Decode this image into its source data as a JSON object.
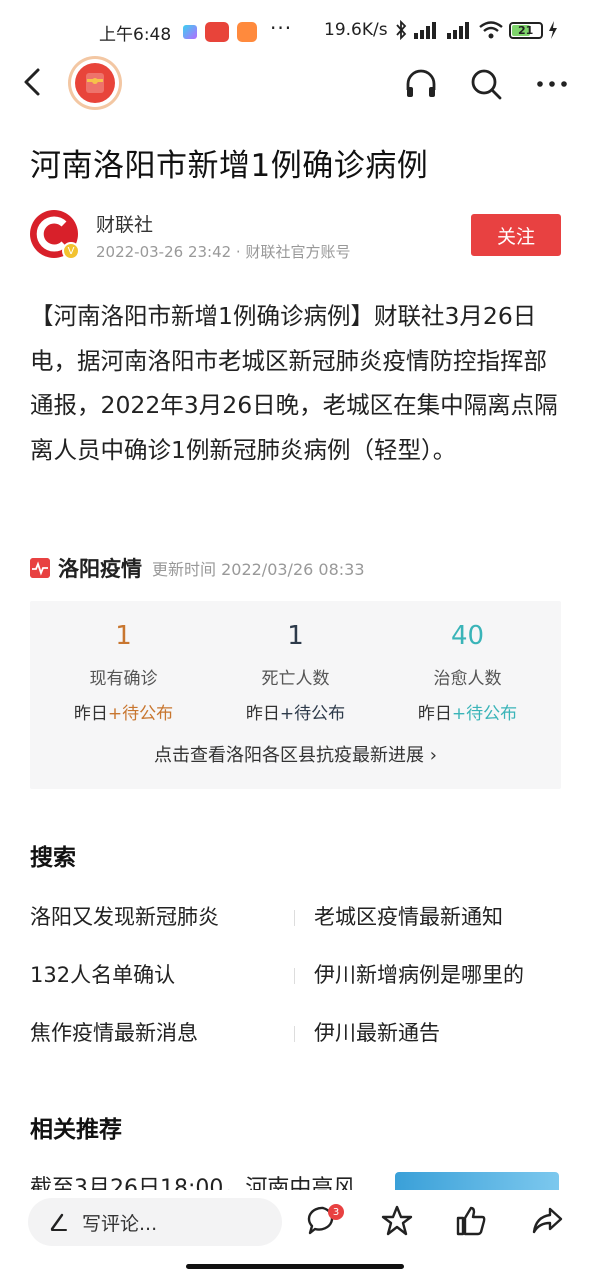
{
  "status_bar": {
    "time": "上午6:48",
    "dots": "···",
    "net_speed": "19.6K/s",
    "battery": "21"
  },
  "nav": {
    "back_icon": "chevron-left-icon",
    "app_logo": "red-envelope-icon",
    "headphone_icon": "headphones-icon",
    "search_icon": "search-icon",
    "more_icon": "more-icon"
  },
  "article": {
    "title": "河南洛阳市新增1例确诊病例",
    "author": "财联社",
    "meta": "2022-03-26 23:42 · 财联社官方账号",
    "follow_label": "关注",
    "body": "【河南洛阳市新增1例确诊病例】财联社3月26日电，据河南洛阳市老城区新冠肺炎疫情防控指挥部通报，2022年3月26日晚，老城区在集中隔离点隔离人员中确诊1例新冠肺炎病例（轻型）。"
  },
  "epidemic": {
    "title": "洛阳疫情",
    "updated": "更新时间 2022/03/26 08:33",
    "stats": [
      {
        "value": "1",
        "label": "现有确诊",
        "sub_prefix": "昨日",
        "sub_value": "+待公布",
        "color": "#c8762f"
      },
      {
        "value": "1",
        "label": "死亡人数",
        "sub_prefix": "昨日",
        "sub_value": "+待公布",
        "color": "#2d3a4a"
      },
      {
        "value": "40",
        "label": "治愈人数",
        "sub_prefix": "昨日",
        "sub_value": "+待公布",
        "color": "#3ab4b8"
      }
    ],
    "link": "点击查看洛阳各区县抗疫最新进展 ›"
  },
  "search": {
    "title": "搜索",
    "rows": [
      [
        "洛阳又发现新冠肺炎",
        "老城区疫情最新通知"
      ],
      [
        "132人名单确认",
        "伊川新增病例是哪里的"
      ],
      [
        "焦作疫情最新消息",
        "伊川最新通告"
      ]
    ]
  },
  "related": {
    "title": "相关推荐",
    "first_item": "截至3月26日18:00，河南中高风"
  },
  "bottom_bar": {
    "comment_placeholder": "写评论...",
    "comment_count": "3",
    "icons": [
      "comment-icon",
      "star-icon",
      "like-icon",
      "share-icon"
    ]
  },
  "colors": {
    "accent_red": "#e84141",
    "orange": "#c8762f",
    "teal": "#3ab4b8"
  }
}
